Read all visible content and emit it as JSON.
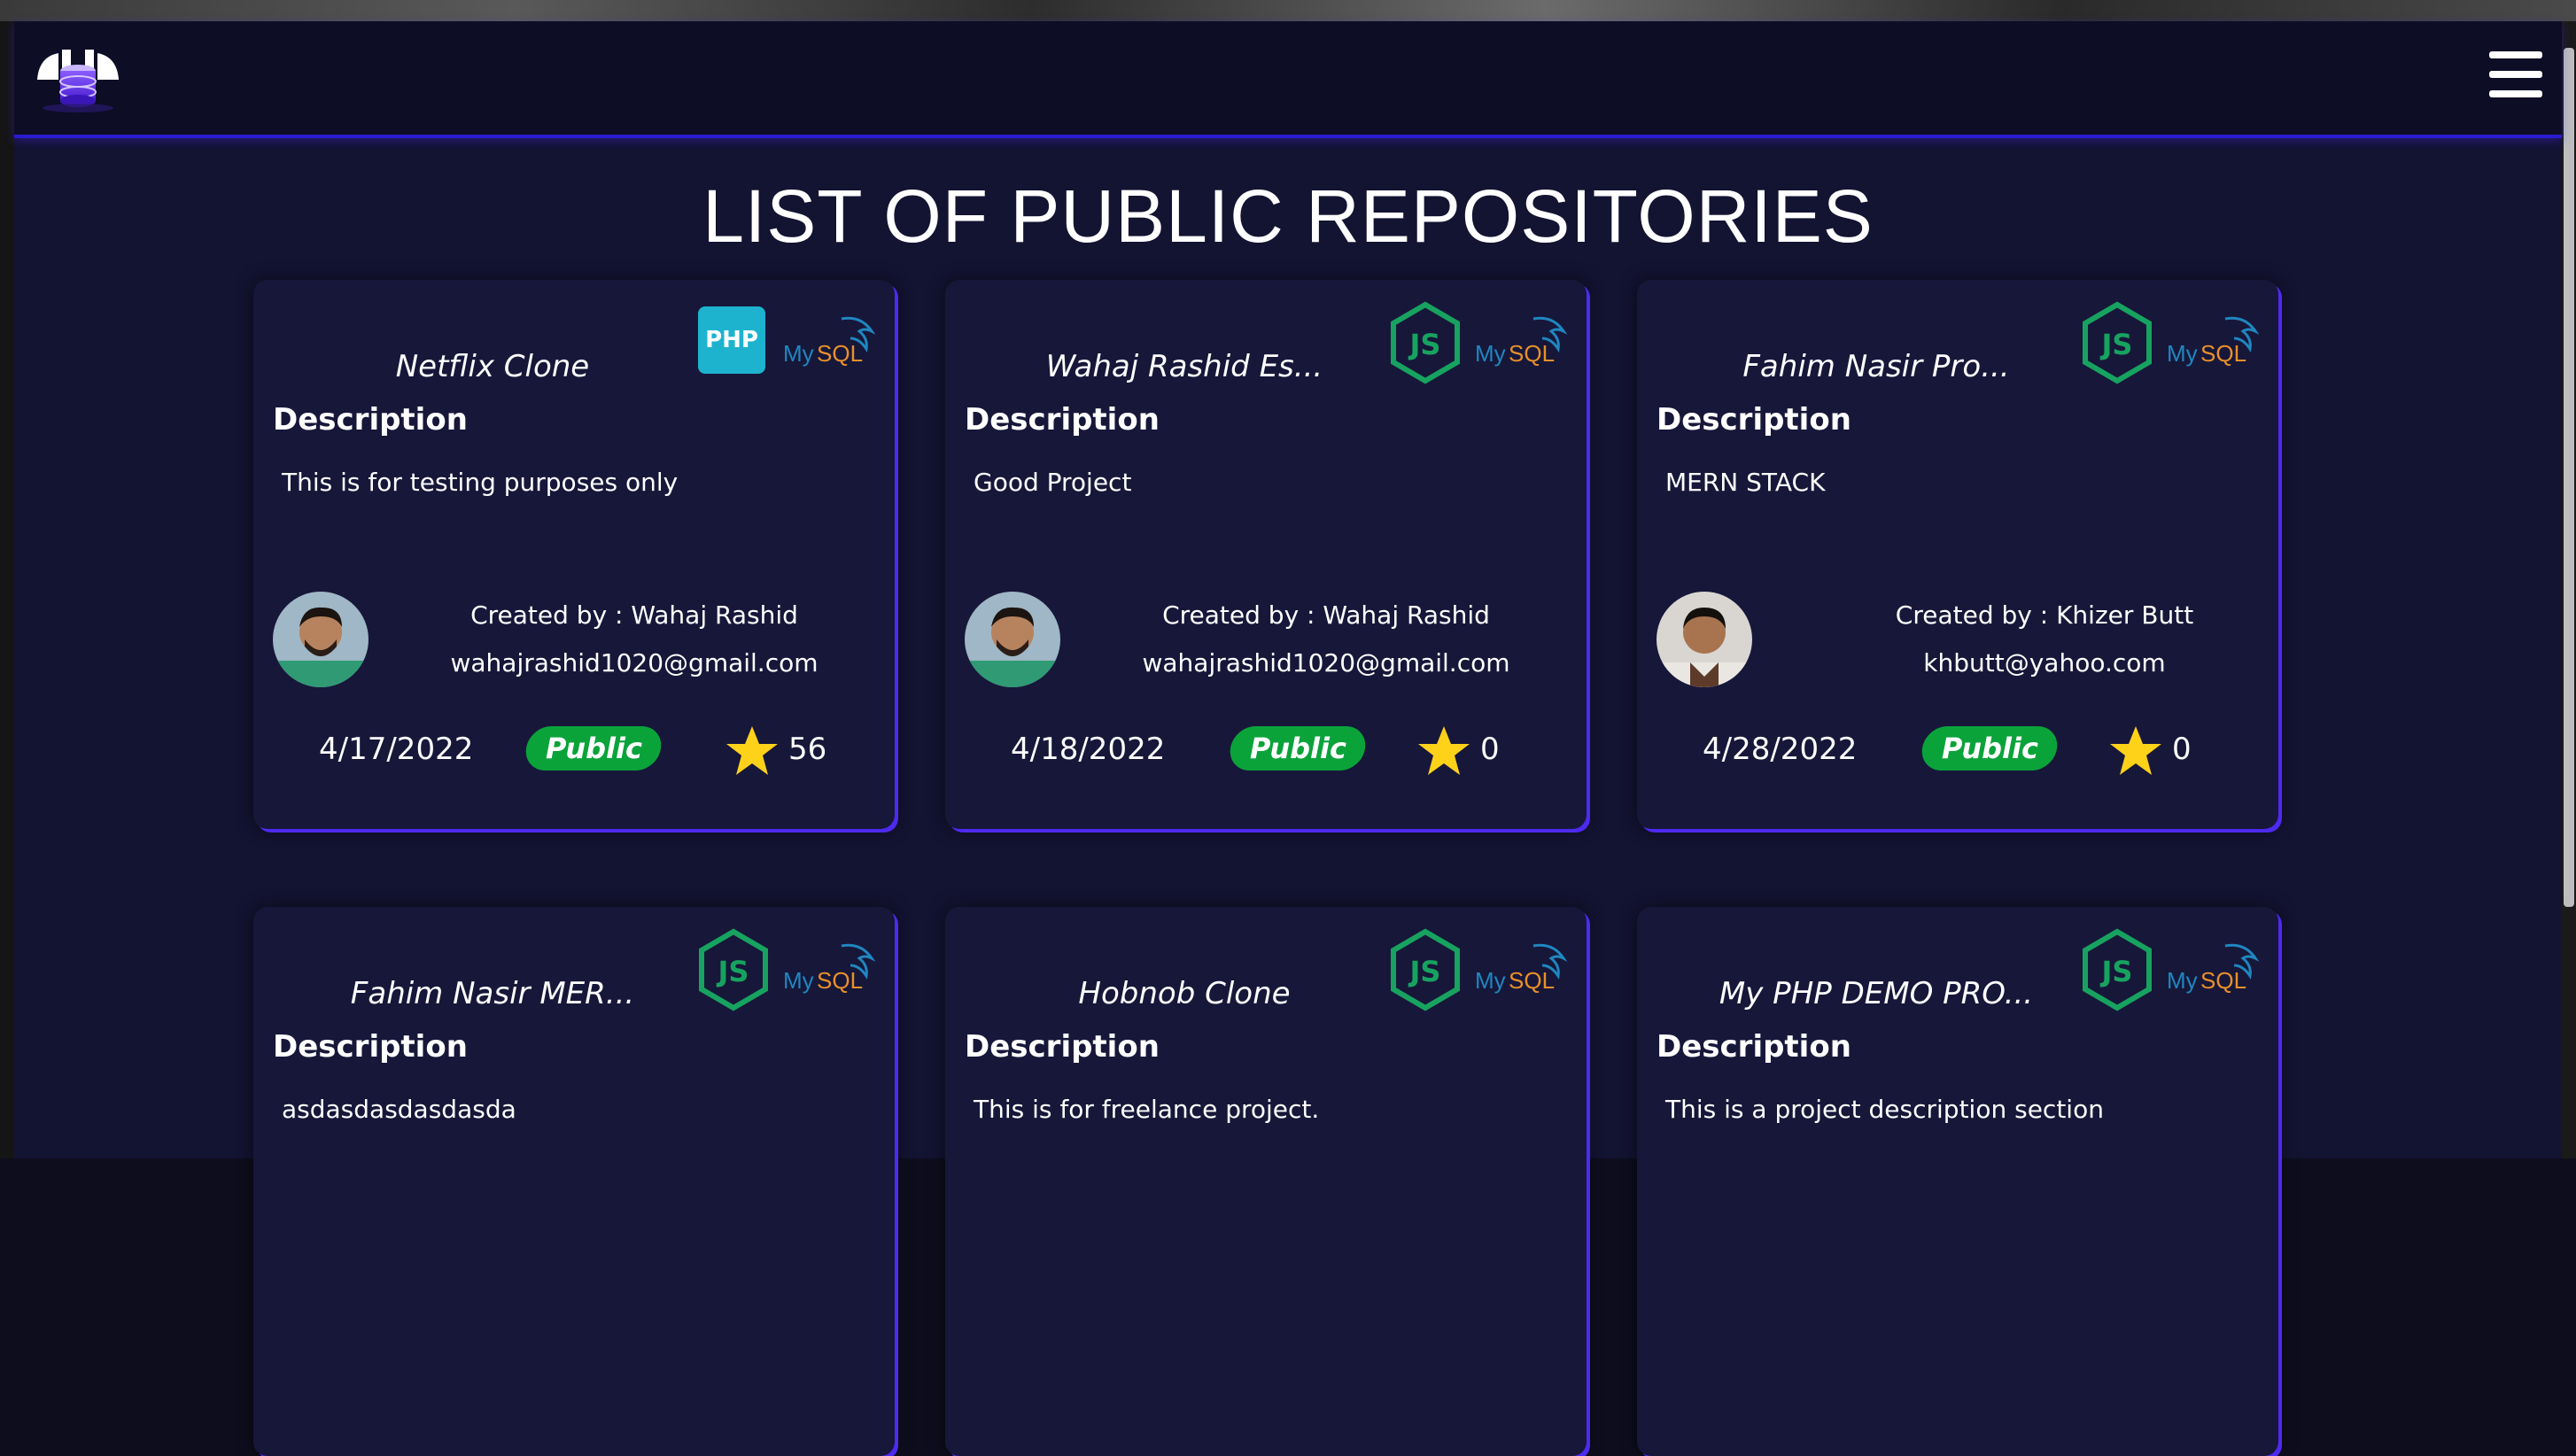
{
  "page": {
    "title": "LIST OF PUBLIC REPOSITORIES"
  },
  "colors": {
    "background": "#131332",
    "navbar": "#0d0d26",
    "accent": "#4e2af0",
    "badge": "#0aa33a",
    "star": "#ffd21a"
  },
  "navbar": {
    "logo_icon": "database-logo-icon",
    "menu_icon": "hamburger-menu-icon"
  },
  "repos": [
    {
      "name": "Netflix Clone",
      "tech": [
        "php",
        "mysql"
      ],
      "description_label": "Description",
      "description": "This is for testing purposes only",
      "created_by": "Created by : Wahaj Rashid",
      "email": "wahajrashid1020@gmail.com",
      "date": "4/17/2022",
      "visibility": "Public",
      "stars": "56"
    },
    {
      "name": "Wahaj Rashid Es...",
      "tech": [
        "nodejs",
        "mysql"
      ],
      "description_label": "Description",
      "description": "Good Project",
      "created_by": "Created by : Wahaj Rashid",
      "email": "wahajrashid1020@gmail.com",
      "date": "4/18/2022",
      "visibility": "Public",
      "stars": "0"
    },
    {
      "name": "Fahim Nasir Pro...",
      "tech": [
        "nodejs",
        "mysql"
      ],
      "description_label": "Description",
      "description": "MERN STACK",
      "created_by": "Created by : Khizer Butt",
      "email": "khbutt@yahoo.com",
      "date": "4/28/2022",
      "visibility": "Public",
      "stars": "0"
    },
    {
      "name": "Fahim Nasir MER...",
      "tech": [
        "nodejs",
        "mysql"
      ],
      "description_label": "Description",
      "description": "asdasdasdasdasda"
    },
    {
      "name": "Hobnob Clone",
      "tech": [
        "nodejs",
        "mysql"
      ],
      "description_label": "Description",
      "description": "This is for freelance project."
    },
    {
      "name": "My PHP DEMO PRO...",
      "tech": [
        "nodejs",
        "mysql"
      ],
      "description_label": "Description",
      "description": "This is a project description section"
    }
  ],
  "tech_labels": {
    "php": "PHP"
  }
}
